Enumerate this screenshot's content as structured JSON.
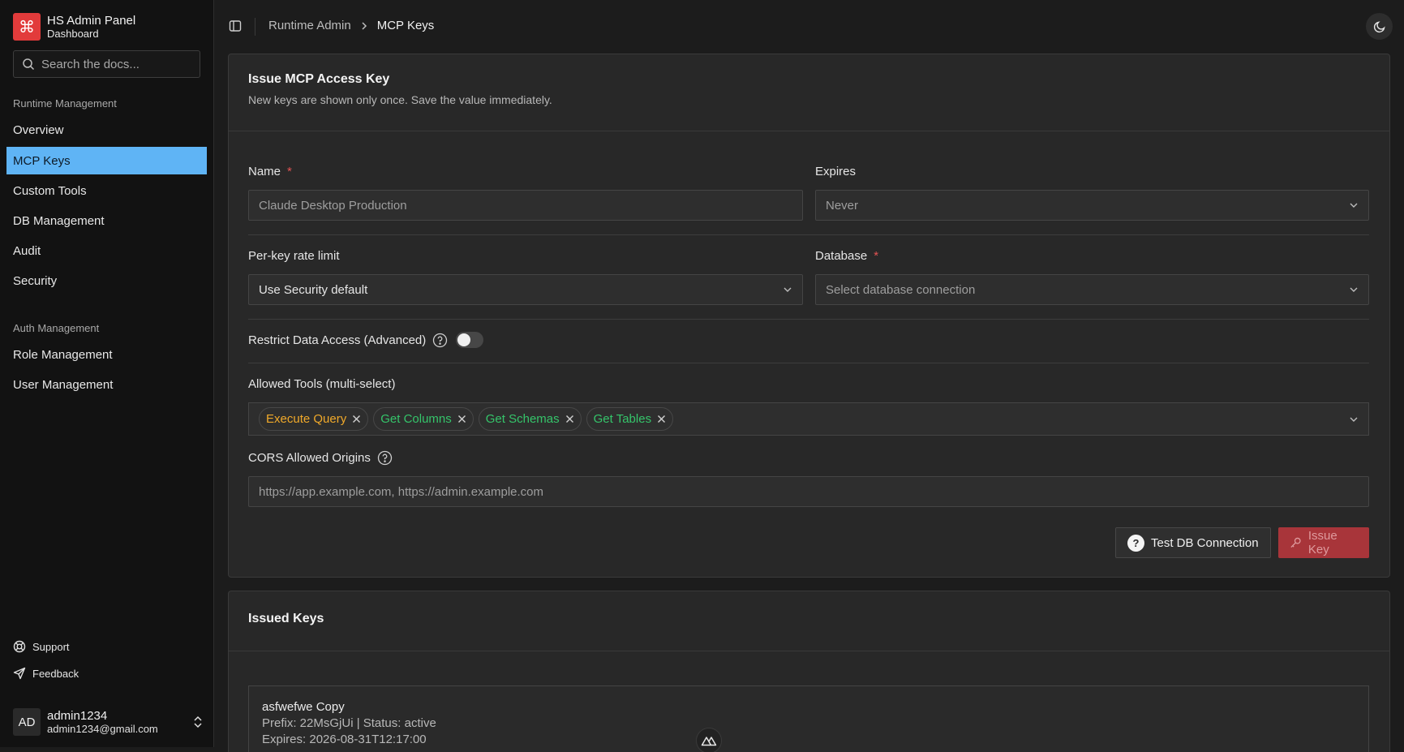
{
  "brand": {
    "title": "HS Admin Panel",
    "subtitle": "Dashboard",
    "logo_icon": "command-icon",
    "color": "#e23b3b"
  },
  "search": {
    "placeholder": "Search the docs..."
  },
  "sidebar": {
    "sections": [
      {
        "label": "Runtime Management",
        "items": [
          {
            "label": "Overview",
            "active": false
          },
          {
            "label": "MCP Keys",
            "active": true
          },
          {
            "label": "Custom Tools",
            "active": false
          },
          {
            "label": "DB Management",
            "active": false
          },
          {
            "label": "Audit",
            "active": false
          },
          {
            "label": "Security",
            "active": false
          }
        ]
      },
      {
        "label": "Auth Management",
        "items": [
          {
            "label": "Role Management",
            "active": false
          },
          {
            "label": "User Management",
            "active": false
          }
        ]
      }
    ],
    "footer": [
      {
        "label": "Support",
        "icon": "lifebuoy-icon"
      },
      {
        "label": "Feedback",
        "icon": "send-icon"
      }
    ],
    "user": {
      "initials": "AD",
      "name": "admin1234",
      "email": "admin1234@gmail.com"
    }
  },
  "header": {
    "breadcrumb": [
      "Runtime Admin",
      "MCP Keys"
    ]
  },
  "issue_card": {
    "title": "Issue MCP Access Key",
    "description": "New keys are shown only once. Save the value immediately.",
    "name": {
      "label": "Name",
      "required": "*",
      "placeholder": "Claude Desktop Production"
    },
    "expires": {
      "label": "Expires",
      "value": "Never"
    },
    "rate_limit": {
      "label": "Per-key rate limit",
      "value": "Use Security default"
    },
    "database": {
      "label": "Database",
      "required": "*",
      "placeholder": "Select database connection"
    },
    "restrict": {
      "label": "Restrict Data Access (Advanced)",
      "enabled": false
    },
    "allowed_tools": {
      "label": "Allowed Tools (multi-select)",
      "tags": [
        {
          "label": "Execute Query",
          "color": "#f0a92a"
        },
        {
          "label": "Get Columns",
          "color": "#35c46a"
        },
        {
          "label": "Get Schemas",
          "color": "#35c46a"
        },
        {
          "label": "Get Tables",
          "color": "#35c46a"
        }
      ]
    },
    "cors": {
      "label": "CORS Allowed Origins",
      "placeholder": "https://app.example.com, https://admin.example.com"
    },
    "buttons": {
      "test": "Test DB Connection",
      "issue": "Issue Key"
    }
  },
  "issued_card": {
    "title": "Issued Keys",
    "keys": [
      {
        "name": "asfwefwe Copy",
        "meta": "Prefix: 22MsGjUi | Status: active",
        "expires": "Expires: 2026-08-31T12:17:00"
      }
    ]
  }
}
